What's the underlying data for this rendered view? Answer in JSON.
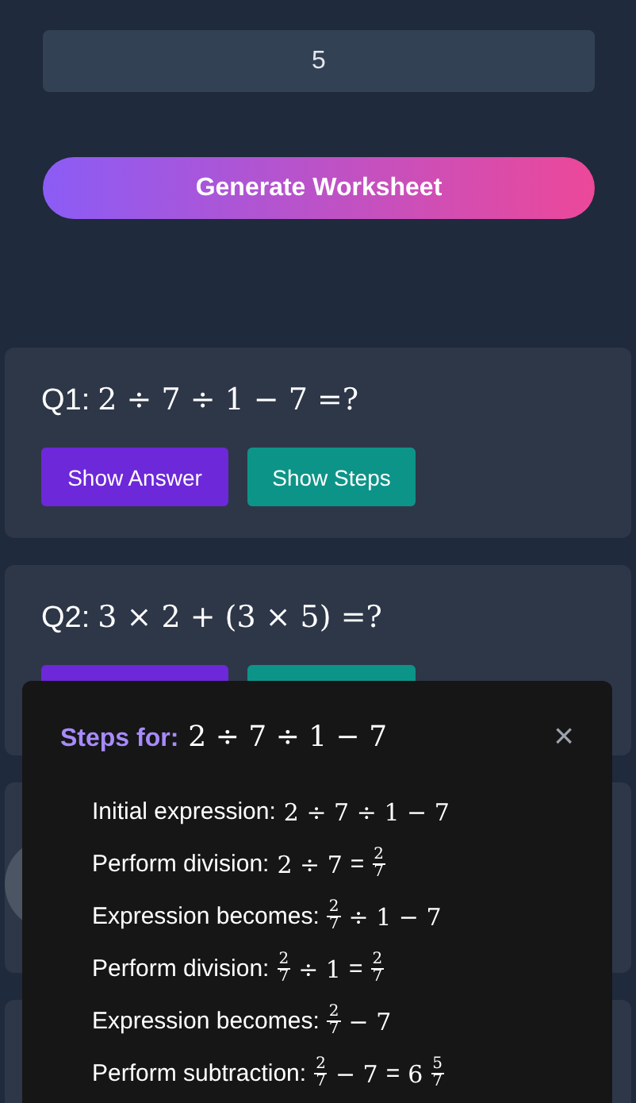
{
  "count_field": {
    "value": "5"
  },
  "generate_button": "Generate Worksheet",
  "questions": [
    {
      "kind": "question",
      "label": "Q1:",
      "expression": "2 ÷ 7 ÷ 1 − 7 =?",
      "buttons": [
        {
          "kind": "answer",
          "label": "Show Answer"
        },
        {
          "kind": "steps",
          "label": "Show Steps"
        }
      ]
    },
    {
      "kind": "question",
      "label": "Q2:",
      "expression": "3 × 2 + (3 × 5) =?",
      "buttons": [
        {
          "kind": "answer"
        },
        {
          "kind": "steps"
        }
      ]
    },
    {
      "kind": "covered",
      "circle": true
    },
    {
      "kind": "covered",
      "circle": false
    }
  ],
  "steps_dialog": {
    "title": "Steps for:",
    "expression": "2 ÷ 7 ÷ 1 − 7",
    "close": "×",
    "steps": [
      {
        "label": "Initial expression:",
        "math": [
          {
            "kind": "text",
            "text": "2 ÷ 7 ÷ 1 − 7"
          }
        ]
      },
      {
        "label": "Perform division:",
        "math": [
          {
            "kind": "text",
            "text": "2 ÷ 7"
          },
          {
            "kind": "eq",
            "text": "="
          },
          {
            "kind": "frac",
            "num": "2",
            "den": "7"
          }
        ]
      },
      {
        "label": "Expression becomes:",
        "math": [
          {
            "kind": "frac",
            "num": "2",
            "den": "7"
          },
          {
            "kind": "text",
            "text": "÷ 1 − 7"
          }
        ]
      },
      {
        "label": "Perform division:",
        "math": [
          {
            "kind": "frac",
            "num": "2",
            "den": "7"
          },
          {
            "kind": "text",
            "text": "÷ 1"
          },
          {
            "kind": "eq",
            "text": "="
          },
          {
            "kind": "frac",
            "num": "2",
            "den": "7"
          }
        ]
      },
      {
        "label": "Expression becomes:",
        "math": [
          {
            "kind": "frac",
            "num": "2",
            "den": "7"
          },
          {
            "kind": "text",
            "text": "− 7"
          }
        ]
      },
      {
        "label": "Perform subtraction:",
        "math": [
          {
            "kind": "frac",
            "num": "2",
            "den": "7"
          },
          {
            "kind": "text",
            "text": "− 7"
          },
          {
            "kind": "eq",
            "text": "="
          },
          {
            "kind": "text",
            "text": "6"
          },
          {
            "kind": "frac",
            "num": "5",
            "den": "7"
          }
        ]
      }
    ]
  }
}
